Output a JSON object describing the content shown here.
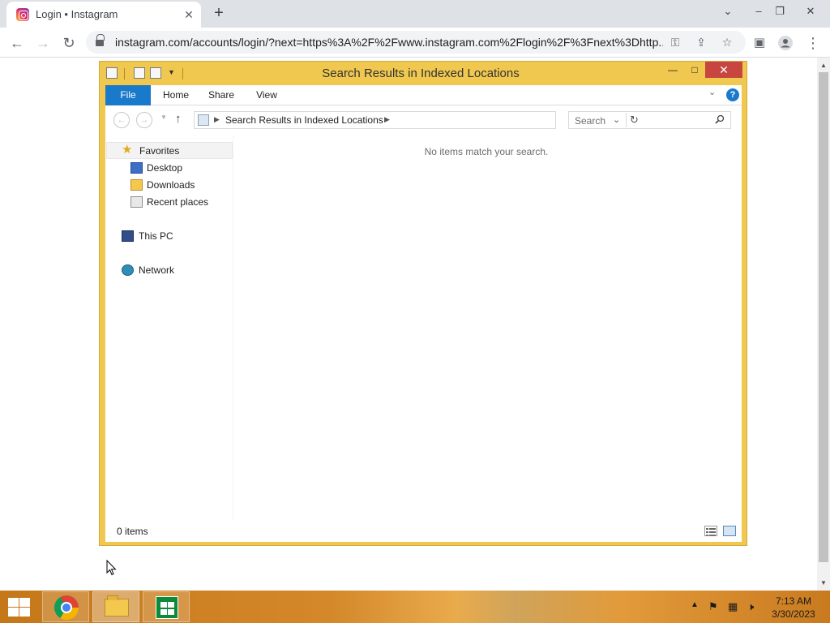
{
  "browser": {
    "tab_title": "Login • Instagram",
    "url": "instagram.com/accounts/login/?next=https%3A%2F%2Fwww.instagram.com%2Flogin%2F%3Fnext%3Dhttp...",
    "icons": {
      "back": "arrow-left",
      "forward": "arrow-right",
      "reload": "reload",
      "lock": "lock",
      "key": "key",
      "share": "share",
      "bookmark": "star",
      "side_panel": "side-panel",
      "profile": "person",
      "menu": "kebab"
    }
  },
  "explorer": {
    "title": "Search Results in Indexed Locations",
    "ribbon_tabs": [
      "File",
      "Home",
      "Share",
      "View"
    ],
    "address_path": "Search Results in Indexed Locations",
    "search_placeholder": "Search",
    "nav_pane": {
      "favorites": "Favorites",
      "favorite_items": [
        "Desktop",
        "Downloads",
        "Recent places"
      ],
      "this_pc": "This PC",
      "network": "Network"
    },
    "empty_message": "No items match your search.",
    "status": "0 items"
  },
  "taskbar": {
    "apps": [
      "Google Chrome",
      "File Explorer",
      "Store"
    ],
    "time": "7:13 AM",
    "date": "3/30/2023",
    "accent": "#d4882a"
  }
}
